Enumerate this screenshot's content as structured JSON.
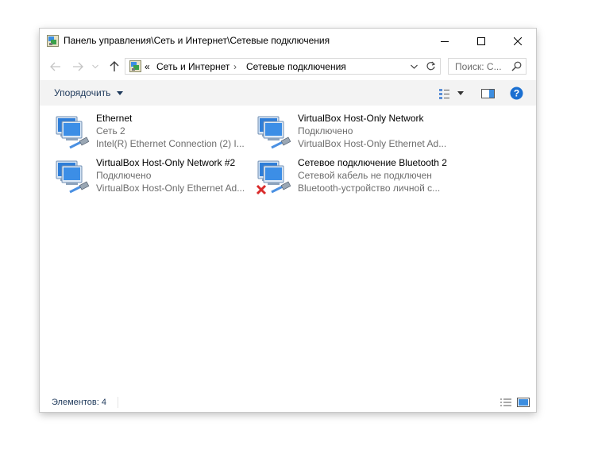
{
  "window": {
    "title": "Панель управления\\Сеть и Интернет\\Сетевые подключения",
    "icon": "control-panel-network-icon"
  },
  "window_controls": {
    "minimize": "minimize-icon",
    "maximize": "maximize-icon",
    "close": "close-icon"
  },
  "navbar": {
    "back_icon": "back-arrow-icon",
    "forward_icon": "forward-arrow-icon",
    "up_icon": "up-arrow-icon",
    "overflow": "«",
    "breadcrumbs": [
      "Сеть и Интернет",
      "Сетевые подключения"
    ],
    "search_placeholder": "Поиск: С..."
  },
  "cmdbar": {
    "organize_label": "Упорядочить"
  },
  "connections": [
    {
      "name": "Ethernet",
      "status": "Сеть 2",
      "device": "Intel(R) Ethernet Connection (2) I...",
      "disconnected": false
    },
    {
      "name": "VirtualBox Host-Only Network",
      "status": "Подключено",
      "device": "VirtualBox Host-Only Ethernet Ad...",
      "disconnected": false
    },
    {
      "name": "VirtualBox Host-Only Network #2",
      "status": "Подключено",
      "device": "VirtualBox Host-Only Ethernet Ad...",
      "disconnected": false
    },
    {
      "name": "Сетевое подключение Bluetooth 2",
      "status": "Сетевой кабель не подключен",
      "device": "Bluetooth-устройство личной с...",
      "disconnected": true
    }
  ],
  "statusbar": {
    "items_count": "Элементов: 4"
  },
  "colors": {
    "accent_blue": "#1e74c8",
    "help_blue": "#1a6fd1",
    "cmdbar_bg": "#f3f3f3",
    "link_text": "#1e395b",
    "secondary_text": "#6d6d6d",
    "error_red": "#d92b2b"
  }
}
